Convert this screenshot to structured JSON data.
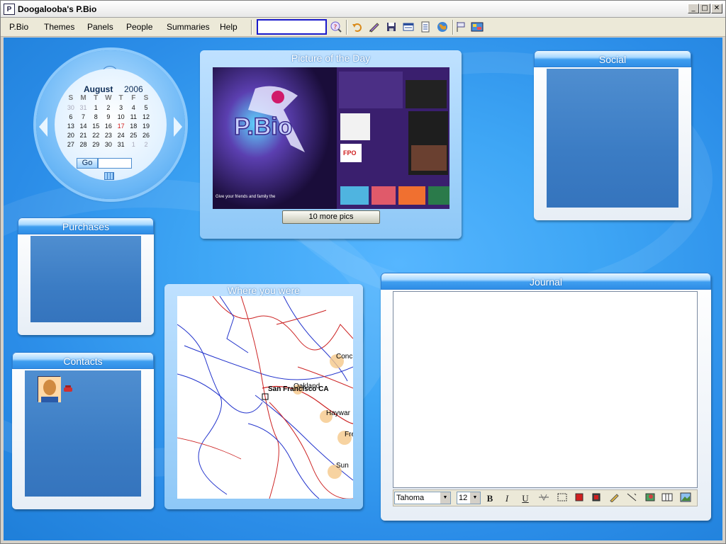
{
  "window": {
    "title": "Doogalooba's P.Bio"
  },
  "menu": [
    {
      "label": "P.Bio"
    },
    {
      "label": "Themes"
    },
    {
      "label": "Panels"
    },
    {
      "label": "People"
    },
    {
      "label": "Summaries"
    },
    {
      "label": "Help"
    }
  ],
  "search": {
    "value": ""
  },
  "calendar": {
    "month": "August",
    "year": "2006",
    "days_of_week": [
      "S",
      "M",
      "T",
      "W",
      "T",
      "F",
      "S"
    ],
    "weeks": [
      [
        "30",
        "31",
        "1",
        "2",
        "3",
        "4",
        "5"
      ],
      [
        "6",
        "7",
        "8",
        "9",
        "10",
        "11",
        "12"
      ],
      [
        "13",
        "14",
        "15",
        "16",
        "17",
        "18",
        "19"
      ],
      [
        "20",
        "21",
        "22",
        "23",
        "24",
        "25",
        "26"
      ],
      [
        "27",
        "28",
        "29",
        "30",
        "31",
        "1",
        "2"
      ]
    ],
    "today": "17",
    "go_label": "Go",
    "go_value": ""
  },
  "panels": {
    "potd": {
      "title": "Picture of the Day",
      "button": "10 more pics",
      "image_logo": "P.Bio",
      "image_caption": "Give your friends and family the "
    },
    "social": {
      "title": "Social"
    },
    "purchases": {
      "title": "Purchases"
    },
    "contacts": {
      "title": "Contacts"
    },
    "map": {
      "title": "Where you were",
      "labels": [
        "San Francisco CA",
        "Oakland",
        "Conc",
        "Haywar",
        "Fre",
        "Sun"
      ]
    },
    "journal": {
      "title": "Journal",
      "text": "",
      "font": "Tahoma",
      "size": "12",
      "bold": "B",
      "italic": "I",
      "underline": "U"
    }
  },
  "colors": {
    "desktop": "#3ea6f5",
    "panel_header": "#2f8de6",
    "search_border": "#1a1acb",
    "today": "#d21a1a"
  }
}
